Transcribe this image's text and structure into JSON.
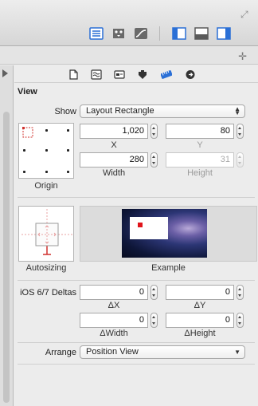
{
  "panel": {
    "section_title": "View",
    "show": {
      "label": "Show",
      "value": "Layout Rectangle"
    },
    "origin_label": "Origin",
    "x": {
      "label": "X",
      "value": "1,020"
    },
    "y": {
      "label": "Y",
      "value": "80"
    },
    "width": {
      "label": "Width",
      "value": "280"
    },
    "height": {
      "label": "Height",
      "value": "31"
    },
    "autosizing_label": "Autosizing",
    "example_label": "Example",
    "deltas": {
      "label": "iOS 6/7 Deltas",
      "dx": {
        "label": "ΔX",
        "value": "0"
      },
      "dy": {
        "label": "ΔY",
        "value": "0"
      },
      "dwidth": {
        "label": "ΔWidth",
        "value": "0"
      },
      "dheight": {
        "label": "ΔHeight",
        "value": "0"
      }
    },
    "arrange": {
      "label": "Arrange",
      "value": "Position View"
    }
  },
  "toolbar": {
    "icons": [
      "editor-standard-icon",
      "editor-assistant-icon",
      "editor-version-icon",
      "navigator-toggle-icon",
      "debug-area-toggle-icon",
      "utilities-toggle-icon"
    ]
  },
  "tabs": [
    "file-inspector-icon",
    "quick-help-icon",
    "identity-inspector-icon",
    "attributes-inspector-icon",
    "size-inspector-icon",
    "connections-inspector-icon"
  ],
  "colors": {
    "accent": "#2a6fd6",
    "autosizing_red": "#d0312d"
  }
}
